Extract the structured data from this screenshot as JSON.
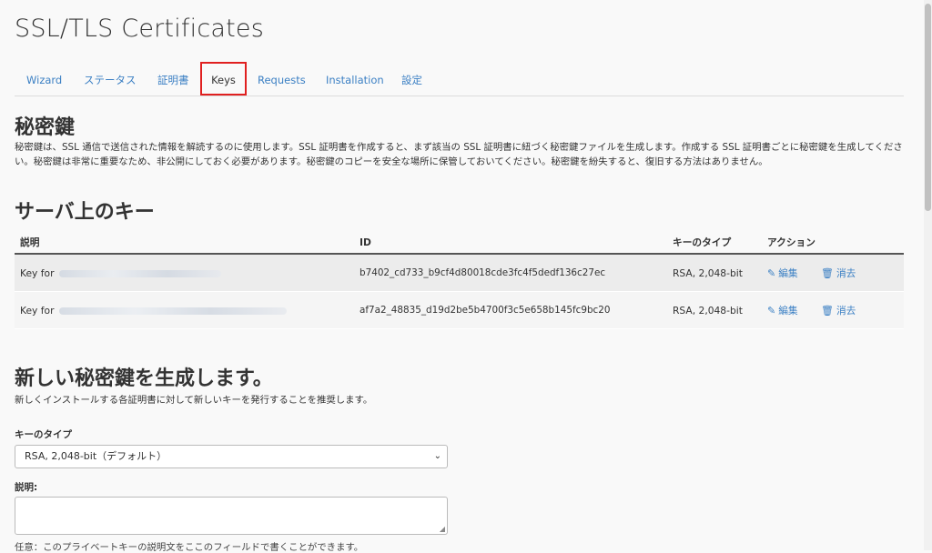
{
  "page": {
    "title": "SSL/TLS Certificates"
  },
  "tabs": [
    {
      "label": "Wizard"
    },
    {
      "label": "ステータス"
    },
    {
      "label": "証明書"
    },
    {
      "label": "Keys",
      "active": true
    },
    {
      "label": "Requests"
    },
    {
      "label": "Installation"
    },
    {
      "label": "設定"
    }
  ],
  "private_keys": {
    "heading": "秘密鍵",
    "description": "秘密鍵は、SSL 通信で送信された情報を解読するのに使用します。SSL 証明書を作成すると、まず該当の SSL 証明書に紐づく秘密鍵ファイルを生成します。作成する SSL 証明書ごとに秘密鍵を生成してください。秘密鍵は非常に重要なため、非公開にしておく必要があります。秘密鍵のコピーを安全な場所に保管しておいてください。秘密鍵を紛失すると、復旧する方法はありません。"
  },
  "server_keys": {
    "heading": "サーバ上のキー",
    "columns": {
      "description": "説明",
      "id": "ID",
      "key_type": "キーのタイプ",
      "actions": "アクション"
    },
    "rows": [
      {
        "description_prefix": "Key for",
        "id": "b7402_cd733_b9cf4d80018cde3fc4f5dedf136c27ec",
        "key_type": "RSA, 2,048-bit",
        "edit": "編集",
        "delete": "消去"
      },
      {
        "description_prefix": "Key for",
        "id": "af7a2_48835_d19d2be5b4700f3c5e658b145fc9bc20",
        "key_type": "RSA, 2,048-bit",
        "edit": "編集",
        "delete": "消去"
      }
    ]
  },
  "generate": {
    "heading": "新しい秘密鍵を生成します。",
    "subtitle": "新しくインストールする各証明書に対して新しいキーを発行することを推奨します。",
    "key_type_label": "キーのタイプ",
    "key_type_value": "RSA, 2,048-bit（デフォルト）",
    "description_label": "説明:",
    "description_hint": "任意：このプライベートキーの説明文をここのフィールドで書くことができます。"
  },
  "colors": {
    "link": "#3c80c4",
    "active_tab_border": "#e02020"
  }
}
